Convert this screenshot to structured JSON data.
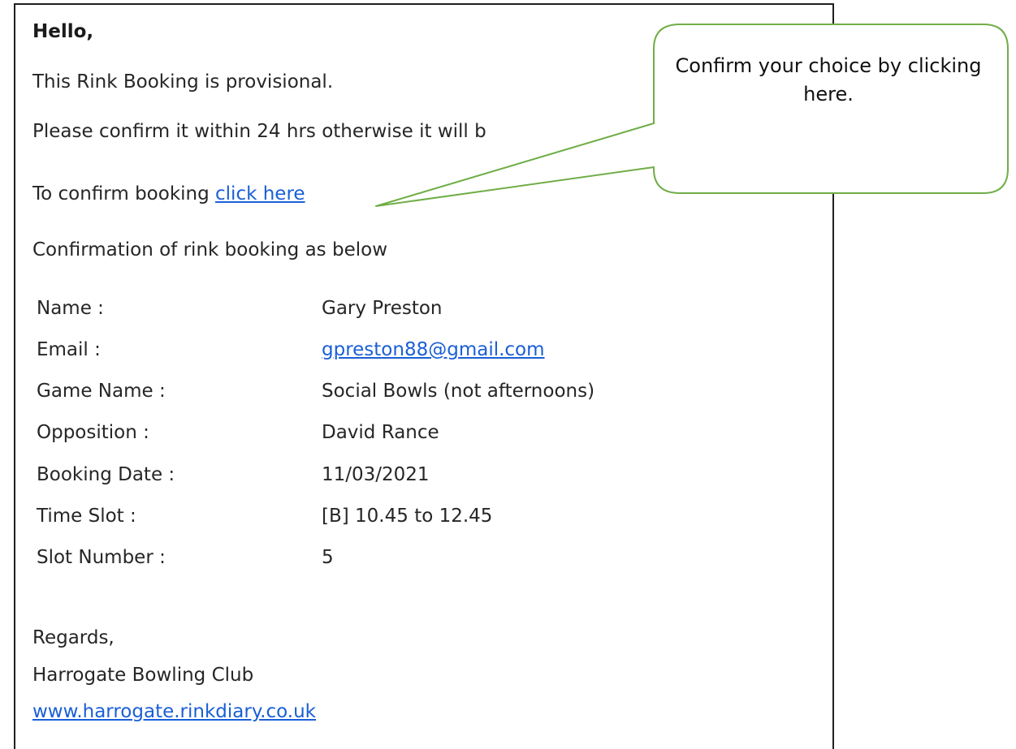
{
  "email": {
    "greeting": "Hello,",
    "line_provisional": "This Rink Booking is provisional.",
    "line_confirm_within": "Please confirm it within 24 hrs otherwise it will b",
    "confirm_prefix": "To confirm booking ",
    "confirm_link": "click here",
    "confirmation_intro": "Confirmation of rink booking as below",
    "details": [
      {
        "label": "Name :",
        "value": "Gary Preston"
      },
      {
        "label": "Email :",
        "value": "gpreston88@gmail.com"
      },
      {
        "label": "Game Name :",
        "value": "Social Bowls (not afternoons)"
      },
      {
        "label": "Opposition :",
        "value": "David Rance"
      },
      {
        "label": "Booking Date :",
        "value": "11/03/2021"
      },
      {
        "label": "Time Slot :",
        "value": "[B] 10.45 to 12.45"
      },
      {
        "label": "Slot Number :",
        "value": "5"
      }
    ],
    "signoff": "Regards,",
    "club_name": "Harrogate Bowling Club",
    "website": "www.harrogate.rinkdiary.co.uk"
  },
  "callout": {
    "text": "Confirm your choice by clicking here.",
    "border_color": "#70ad47"
  },
  "colors": {
    "link": "#1a5fd6",
    "text": "#262626",
    "panel_border": "#1f1f1f"
  }
}
